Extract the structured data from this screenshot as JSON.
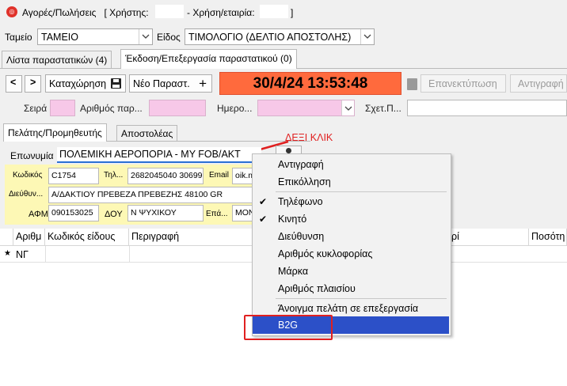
{
  "titlebar": {
    "app_title": "Αγορές/Πωλήσεις",
    "user_label": "[ Χρήστης:",
    "year_label": "- Χρήση/εταιρία:",
    "close_bracket": "]"
  },
  "filters": {
    "cashier_label": "Ταμείο",
    "cashier_value": "ΤΑΜΕΙΟ",
    "type_label": "Είδος",
    "type_value": "ΤΙΜΟΛΟΓΙΟ (ΔΕΛΤΙΟ ΑΠΟΣΤΟΛΗΣ)"
  },
  "main_tabs": [
    {
      "label": "Λίστα παραστατικών (4)"
    },
    {
      "label": "Έκδοση/Επεξεργασία παραστατικού (0)"
    }
  ],
  "toolbar": {
    "back_label": "<",
    "forward_label": ">",
    "save_label": "Καταχώρηση",
    "new_label": "Νέο Παραστ.",
    "datetime": "30/4/24 13:53:48",
    "reprint_label": "Επανεκτύπωση",
    "copy_label": "Αντιγραφή"
  },
  "doc_fields": {
    "series_label": "Σειρά",
    "number_label": "Αριθμός παρ...",
    "date_label": "Ημερο...",
    "related_label": "Σχετ.Π..."
  },
  "party_tabs": [
    {
      "label": "Πελάτης/Προμηθευτής"
    },
    {
      "label": "Αποστολέας"
    }
  ],
  "annotation": {
    "label": "ΔΕΞΙ ΚΛΙΚ",
    "color": "#e02020"
  },
  "customer": {
    "name_label": "Επωνυμία",
    "name_value": "ΠΟΛΕΜΙΚΗ ΑΕΡΟΠΟΡΙΑ - ΜΥ FOB/ΑΚΤ",
    "code_label": "Κωδικός",
    "code_value": "C1754",
    "phone_label": "Τηλ...",
    "phone_value": "2682045040 30699",
    "email_label": "Email",
    "email_value": "oik.m",
    "address_label": "Διεύθυν...",
    "address_value": "Α/ΔΑΚΤΙΟΥ ΠΡΕΒΕΖΑ ΠΡΕΒΕΖΗΣ 48100 GR",
    "vat_label": "ΑΦΜ",
    "vat_value": "090153025",
    "tax_office_label": "ΔΟΥ",
    "tax_office_value": "Ν ΨΥΧΙΚΟΥ",
    "profession_label": "Επά...",
    "profession_value": "MON"
  },
  "grid": {
    "columns": [
      "Αριθμ",
      "Κωδικός είδους",
      "Περιγραφή",
      "ρί",
      "Ποσότη"
    ],
    "row_marker": "★",
    "row_first_cell": "ΝΓ"
  },
  "context_menu": {
    "items": [
      {
        "label": "Αντιγραφή",
        "checked": false
      },
      {
        "label": "Επικόλληση",
        "checked": false
      },
      {
        "label": "Τηλέφωνο",
        "checked": true
      },
      {
        "label": "Κινητό",
        "checked": true
      },
      {
        "label": "Διεύθυνση",
        "checked": false
      },
      {
        "label": "Αριθμός κυκλοφορίας",
        "checked": false
      },
      {
        "label": "Μάρκα",
        "checked": false
      },
      {
        "label": "Αριθμός πλαισίου",
        "checked": false
      },
      {
        "label": "Άνοιγμα πελάτη σε επεξεργασία",
        "checked": false
      },
      {
        "label": "B2G",
        "checked": false
      }
    ],
    "check_glyph": "✔",
    "highlight_color": "#2c50c8"
  },
  "colors": {
    "datetime_bg": "#ff6a3d",
    "pink_field": "#f7c8e8",
    "yellow_panel": "#fdf8b5",
    "annotation_red": "#e02020"
  }
}
